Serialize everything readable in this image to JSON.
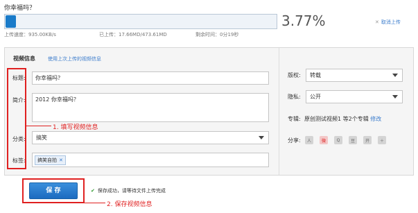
{
  "upload": {
    "title": "你幸福吗？",
    "progress": 0.0377,
    "percent_label": "3.77%",
    "cancel_label": "取消上传",
    "speed": "上传速度：935.00KB/s",
    "uploaded": "已上传：17.66MD/473.61MD",
    "remaining": "剩余时间：0分19秒"
  },
  "panel": {
    "heading": "视频信息",
    "reuse_link": "使用上次上传的视频信息",
    "title_label": "标题:",
    "title_value": "你幸福吗？",
    "intro_label": "简介:",
    "intro_value": "2012 你幸福吗？",
    "category_label": "分类:",
    "category_value": "搞笑",
    "tags_label": "标签:",
    "tag_value": "搞笑自拍"
  },
  "side": {
    "copyright_label": "版权:",
    "copyright_value": "转载",
    "privacy_label": "隐私:",
    "privacy_value": "公开",
    "album_label": "专辑:",
    "album_value": "原创测试视频1 等2个专辑",
    "album_modify": "修改",
    "share_label": "分享:"
  },
  "annotations": {
    "step1": "1. 填写视频信息",
    "step2": "2. 保存视频信息"
  },
  "save": {
    "button": "保 存",
    "message": "保存成功，请等待文件上传完成"
  },
  "colors": {
    "accent": "#1c6bc0",
    "annotation": "#e02020",
    "link": "#3b7ccc"
  }
}
